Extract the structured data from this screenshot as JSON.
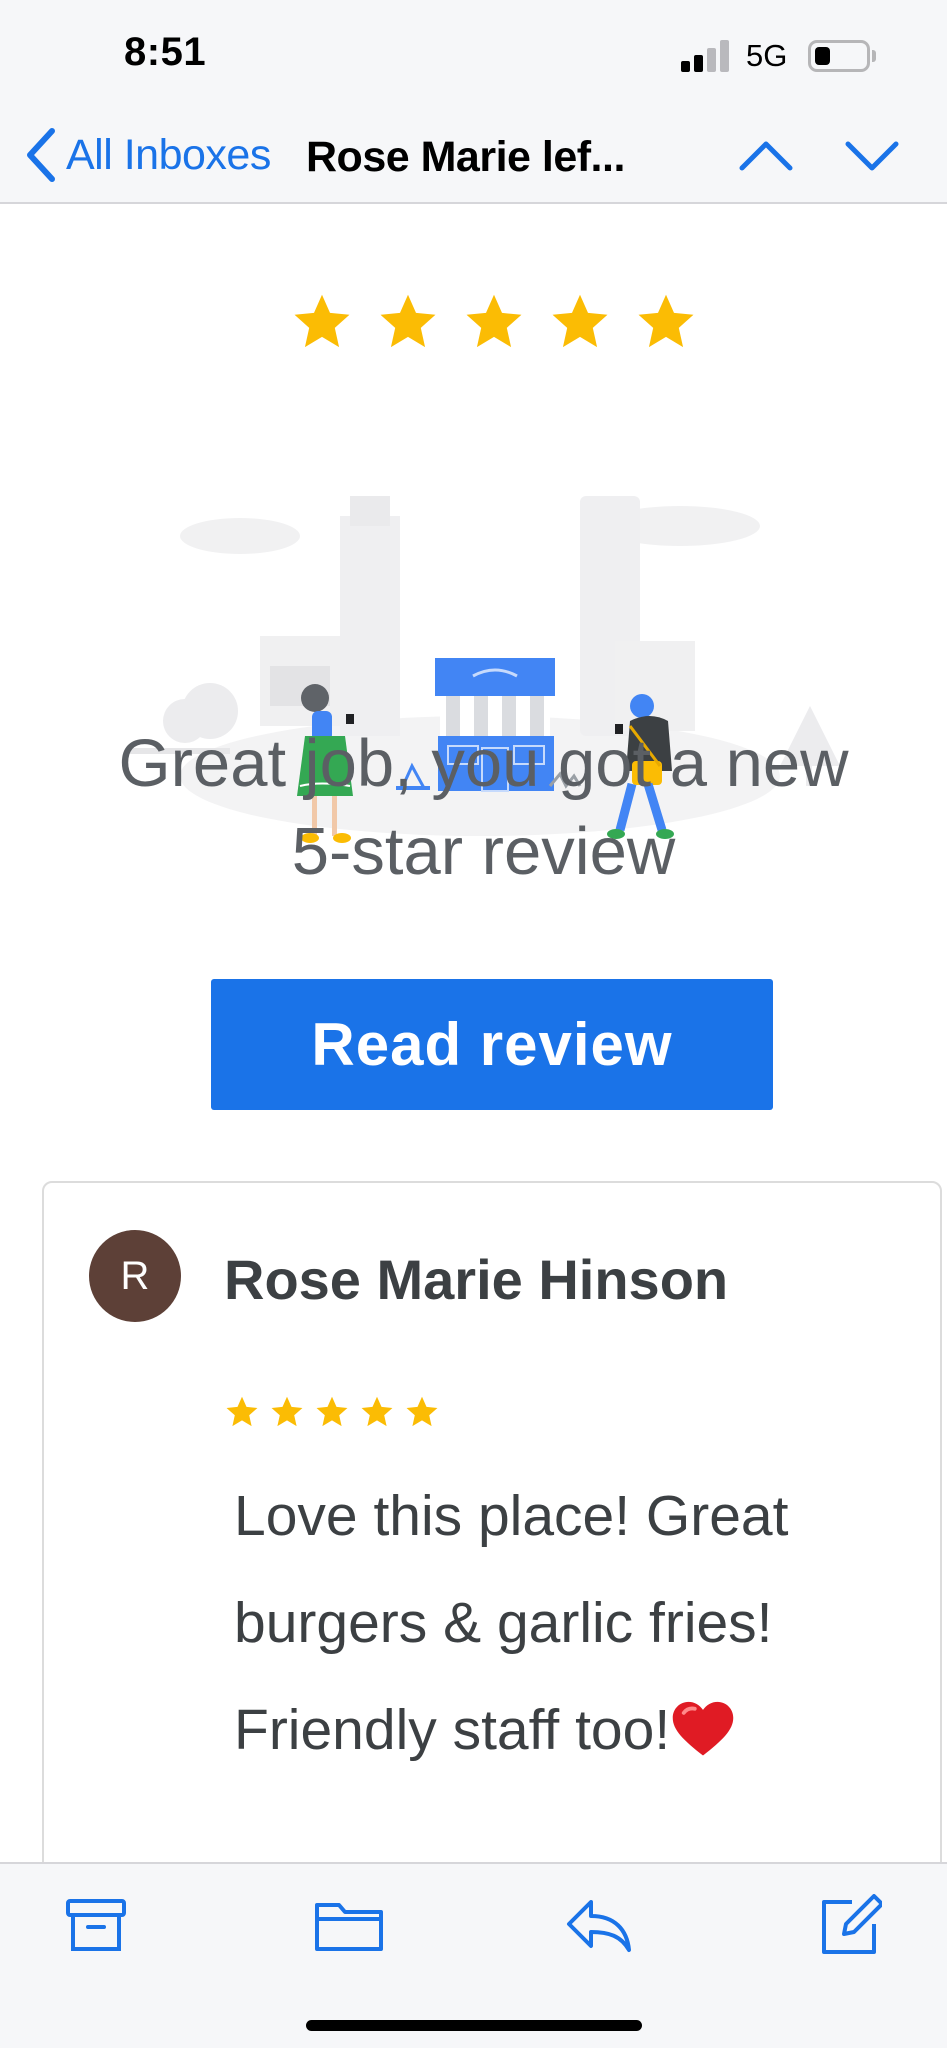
{
  "status_bar": {
    "time": "8:51",
    "network": "5G"
  },
  "nav": {
    "back_label": "All Inboxes",
    "title": "Rose Marie lef...",
    "icons": [
      "chevron-left-icon",
      "chevron-up-icon",
      "chevron-down-icon"
    ],
    "accent_color": "#1a73e8"
  },
  "email": {
    "headline_line1": "Great job, you got a new",
    "headline_line2": "5-star review",
    "cta_label": "Read review",
    "rating": 5,
    "star_color": "#fbbc04",
    "review": {
      "avatar_initial": "R",
      "avatar_color": "#5d4037",
      "reviewer_name": "Rose Marie Hinson",
      "rating": 5,
      "text_line1": "Love this place! Great",
      "text_line2": "burgers & garlic fries!",
      "text_line3": "Friendly staff too!"
    }
  },
  "toolbar": {
    "icons": [
      "archive-icon",
      "folder-icon",
      "reply-icon",
      "compose-icon"
    ]
  }
}
